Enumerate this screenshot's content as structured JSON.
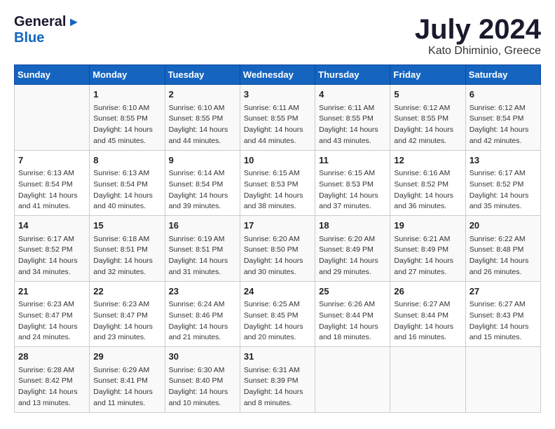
{
  "logo": {
    "general": "General",
    "blue": "Blue"
  },
  "title": "July 2024",
  "location": "Kato Dhiminio, Greece",
  "days_of_week": [
    "Sunday",
    "Monday",
    "Tuesday",
    "Wednesday",
    "Thursday",
    "Friday",
    "Saturday"
  ],
  "weeks": [
    [
      {
        "day": "",
        "content": ""
      },
      {
        "day": "1",
        "content": "Sunrise: 6:10 AM\nSunset: 8:55 PM\nDaylight: 14 hours\nand 45 minutes."
      },
      {
        "day": "2",
        "content": "Sunrise: 6:10 AM\nSunset: 8:55 PM\nDaylight: 14 hours\nand 44 minutes."
      },
      {
        "day": "3",
        "content": "Sunrise: 6:11 AM\nSunset: 8:55 PM\nDaylight: 14 hours\nand 44 minutes."
      },
      {
        "day": "4",
        "content": "Sunrise: 6:11 AM\nSunset: 8:55 PM\nDaylight: 14 hours\nand 43 minutes."
      },
      {
        "day": "5",
        "content": "Sunrise: 6:12 AM\nSunset: 8:55 PM\nDaylight: 14 hours\nand 42 minutes."
      },
      {
        "day": "6",
        "content": "Sunrise: 6:12 AM\nSunset: 8:54 PM\nDaylight: 14 hours\nand 42 minutes."
      }
    ],
    [
      {
        "day": "7",
        "content": "Sunrise: 6:13 AM\nSunset: 8:54 PM\nDaylight: 14 hours\nand 41 minutes."
      },
      {
        "day": "8",
        "content": "Sunrise: 6:13 AM\nSunset: 8:54 PM\nDaylight: 14 hours\nand 40 minutes."
      },
      {
        "day": "9",
        "content": "Sunrise: 6:14 AM\nSunset: 8:54 PM\nDaylight: 14 hours\nand 39 minutes."
      },
      {
        "day": "10",
        "content": "Sunrise: 6:15 AM\nSunset: 8:53 PM\nDaylight: 14 hours\nand 38 minutes."
      },
      {
        "day": "11",
        "content": "Sunrise: 6:15 AM\nSunset: 8:53 PM\nDaylight: 14 hours\nand 37 minutes."
      },
      {
        "day": "12",
        "content": "Sunrise: 6:16 AM\nSunset: 8:52 PM\nDaylight: 14 hours\nand 36 minutes."
      },
      {
        "day": "13",
        "content": "Sunrise: 6:17 AM\nSunset: 8:52 PM\nDaylight: 14 hours\nand 35 minutes."
      }
    ],
    [
      {
        "day": "14",
        "content": "Sunrise: 6:17 AM\nSunset: 8:52 PM\nDaylight: 14 hours\nand 34 minutes."
      },
      {
        "day": "15",
        "content": "Sunrise: 6:18 AM\nSunset: 8:51 PM\nDaylight: 14 hours\nand 32 minutes."
      },
      {
        "day": "16",
        "content": "Sunrise: 6:19 AM\nSunset: 8:51 PM\nDaylight: 14 hours\nand 31 minutes."
      },
      {
        "day": "17",
        "content": "Sunrise: 6:20 AM\nSunset: 8:50 PM\nDaylight: 14 hours\nand 30 minutes."
      },
      {
        "day": "18",
        "content": "Sunrise: 6:20 AM\nSunset: 8:49 PM\nDaylight: 14 hours\nand 29 minutes."
      },
      {
        "day": "19",
        "content": "Sunrise: 6:21 AM\nSunset: 8:49 PM\nDaylight: 14 hours\nand 27 minutes."
      },
      {
        "day": "20",
        "content": "Sunrise: 6:22 AM\nSunset: 8:48 PM\nDaylight: 14 hours\nand 26 minutes."
      }
    ],
    [
      {
        "day": "21",
        "content": "Sunrise: 6:23 AM\nSunset: 8:47 PM\nDaylight: 14 hours\nand 24 minutes."
      },
      {
        "day": "22",
        "content": "Sunrise: 6:23 AM\nSunset: 8:47 PM\nDaylight: 14 hours\nand 23 minutes."
      },
      {
        "day": "23",
        "content": "Sunrise: 6:24 AM\nSunset: 8:46 PM\nDaylight: 14 hours\nand 21 minutes."
      },
      {
        "day": "24",
        "content": "Sunrise: 6:25 AM\nSunset: 8:45 PM\nDaylight: 14 hours\nand 20 minutes."
      },
      {
        "day": "25",
        "content": "Sunrise: 6:26 AM\nSunset: 8:44 PM\nDaylight: 14 hours\nand 18 minutes."
      },
      {
        "day": "26",
        "content": "Sunrise: 6:27 AM\nSunset: 8:44 PM\nDaylight: 14 hours\nand 16 minutes."
      },
      {
        "day": "27",
        "content": "Sunrise: 6:27 AM\nSunset: 8:43 PM\nDaylight: 14 hours\nand 15 minutes."
      }
    ],
    [
      {
        "day": "28",
        "content": "Sunrise: 6:28 AM\nSunset: 8:42 PM\nDaylight: 14 hours\nand 13 minutes."
      },
      {
        "day": "29",
        "content": "Sunrise: 6:29 AM\nSunset: 8:41 PM\nDaylight: 14 hours\nand 11 minutes."
      },
      {
        "day": "30",
        "content": "Sunrise: 6:30 AM\nSunset: 8:40 PM\nDaylight: 14 hours\nand 10 minutes."
      },
      {
        "day": "31",
        "content": "Sunrise: 6:31 AM\nSunset: 8:39 PM\nDaylight: 14 hours\nand 8 minutes."
      },
      {
        "day": "",
        "content": ""
      },
      {
        "day": "",
        "content": ""
      },
      {
        "day": "",
        "content": ""
      }
    ]
  ]
}
